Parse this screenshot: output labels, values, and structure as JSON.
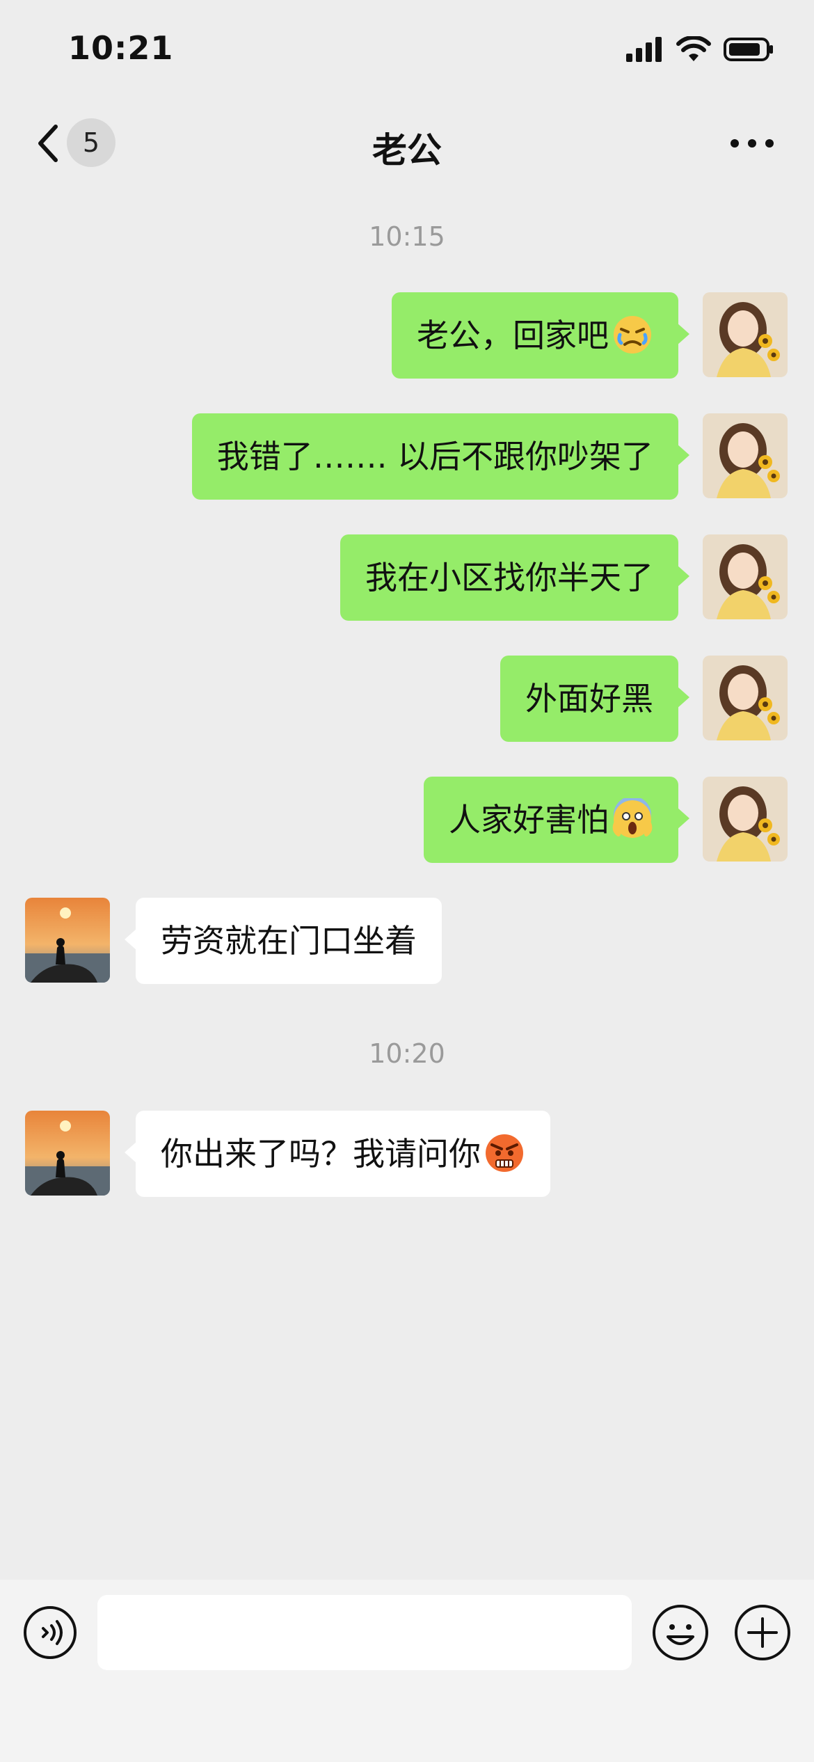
{
  "status_bar": {
    "time": "10:21",
    "icons": [
      "signal-icon",
      "wifi-icon",
      "battery-icon"
    ]
  },
  "header": {
    "back_icon": "chevron-left-icon",
    "unread_count": "5",
    "title": "老公",
    "more_icon": "ellipsis-icon"
  },
  "chat": {
    "timestamp_1": "10:15",
    "timestamp_2": "10:20",
    "messages": [
      {
        "sender": "me",
        "text": "老公，回家吧",
        "emoji": "crying-face"
      },
      {
        "sender": "me",
        "text": "我错了……. 以后不跟你吵架了"
      },
      {
        "sender": "me",
        "text": "我在小区找你半天了"
      },
      {
        "sender": "me",
        "text": "外面好黑"
      },
      {
        "sender": "me",
        "text": "人家好害怕",
        "emoji": "screaming-face"
      },
      {
        "sender": "other",
        "text": "劳资就在门口坐着"
      },
      {
        "sender": "other",
        "text": "你出来了吗？我请问你",
        "emoji": "angry-face"
      }
    ]
  },
  "input_bar": {
    "voice_icon": "voice-icon",
    "emoji_icon": "smiley-icon",
    "plus_icon": "plus-icon"
  },
  "colors": {
    "background": "#ededed",
    "my_bubble": "#95ec69",
    "other_bubble": "#ffffff"
  }
}
